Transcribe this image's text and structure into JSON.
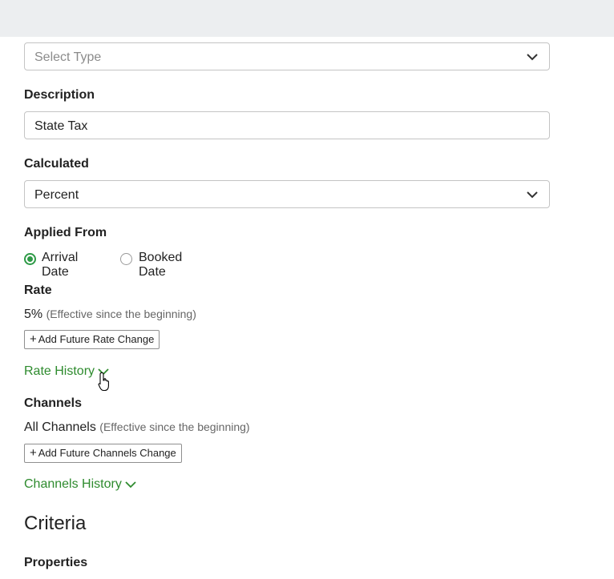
{
  "type_select": {
    "placeholder": "Select Type",
    "icon": "chevron-down-icon"
  },
  "description": {
    "label": "Description",
    "value": "State Tax"
  },
  "calculated": {
    "label": "Calculated",
    "value": "Percent",
    "icon": "chevron-down-icon"
  },
  "applied_from": {
    "label": "Applied From",
    "options": [
      {
        "label": "Arrival Date",
        "selected": true
      },
      {
        "label": "Booked Date",
        "selected": false
      }
    ]
  },
  "rate": {
    "label": "Rate",
    "value": "5%",
    "note": "(Effective since the beginning)",
    "add_button": "Add Future Rate Change",
    "history_link": "Rate History"
  },
  "channels": {
    "label": "Channels",
    "value": "All Channels",
    "note": "(Effective since the beginning)",
    "add_button": "Add Future Channels Change",
    "history_link": "Channels History"
  },
  "criteria": {
    "title": "Criteria",
    "properties_label": "Properties"
  },
  "colors": {
    "accent_green": "#2e8b2e",
    "topbar": "#eceef0",
    "border": "#c4c4c4"
  }
}
